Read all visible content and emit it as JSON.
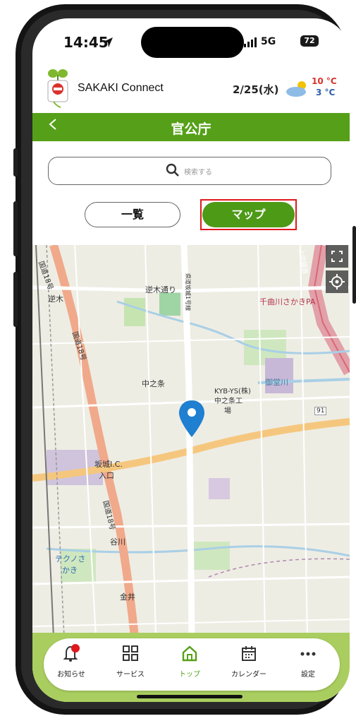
{
  "status": {
    "time": "14:45",
    "network": "5G",
    "battery": "72"
  },
  "header": {
    "app_name": "SAKAKI Connect",
    "date": "2/25(水)",
    "temp_high": "10 °C",
    "temp_low": "3 °C",
    "weather_icon": "cloud-sun-icon"
  },
  "titlebar": {
    "title": "官公庁",
    "back_icon": "chevron-left-icon"
  },
  "search": {
    "placeholder": "検索する"
  },
  "segments": {
    "list_label": "一覧",
    "map_label": "マップ",
    "selected": "マップ"
  },
  "map": {
    "labels": {
      "sakakimachi": "逆木通り",
      "sakaki": "逆木",
      "chikuma_pa": "千曲川さかきPA",
      "nakanojo": "中之条",
      "kyb": "KYB-YS(株)",
      "kyb2": "中之条工",
      "kyb3": "場",
      "goudo": "御堂川",
      "sakaki_ic": "坂城I.C.",
      "iriguchi": "入口",
      "route18a": "国道18号",
      "route18b": "国道18号",
      "route18c": "国道18号",
      "techno1": "テクノさ",
      "techno2": "かき",
      "kanai": "金井",
      "tanigawa": "谷川",
      "route91": "91",
      "highway": "上信越道",
      "pref_road": "県道坂城1号線"
    }
  },
  "tabbar": {
    "items": [
      {
        "label": "お知らせ",
        "icon": "bell-icon",
        "badge": true
      },
      {
        "label": "サービス",
        "icon": "grid-icon"
      },
      {
        "label": "トップ",
        "icon": "home-icon",
        "active": true
      },
      {
        "label": "カレンダー",
        "icon": "calendar-icon"
      },
      {
        "label": "設定",
        "icon": "more-icon"
      }
    ],
    "active_color": "#55a018"
  },
  "colors": {
    "brand_green": "#55a018",
    "highlight_red": "#e0181b",
    "pin_blue": "#1f7fd0"
  }
}
